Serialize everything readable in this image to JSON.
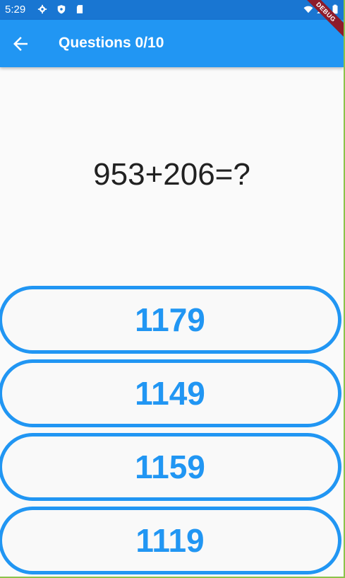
{
  "status_bar": {
    "time": "5:29",
    "icons": [
      "gear-icon",
      "shield-icon",
      "sd-card-icon",
      "wifi-icon",
      "signal-icon",
      "battery-icon"
    ]
  },
  "app_bar": {
    "back_icon": "arrow-left-icon",
    "title": "Questions 0/10"
  },
  "debug_banner": "DEBUG",
  "question": "953+206=?",
  "answers": [
    "1179",
    "1149",
    "1159",
    "1119"
  ],
  "colors": {
    "primary": "#2196f3",
    "status_bar": "#1976d2",
    "debug": "#8e1b2a"
  }
}
